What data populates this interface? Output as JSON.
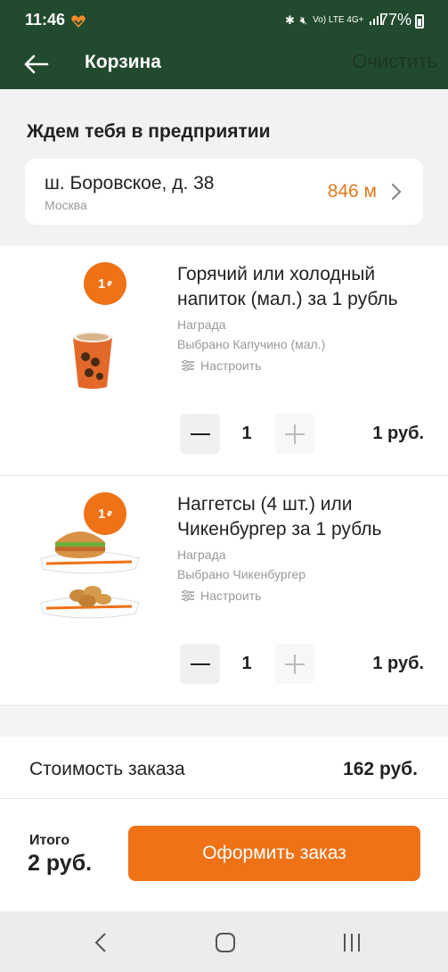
{
  "status_bar": {
    "time": "11:46",
    "signal_labels": "Vo) LTE 4G+",
    "battery": "77%"
  },
  "app_bar": {
    "title": "Корзина",
    "clear_label": "Очистить"
  },
  "pickup": {
    "heading": "Ждем тебя в предприятии",
    "street": "ш. Боровское, д. 38",
    "city": "Москва",
    "distance": "846 м"
  },
  "items": [
    {
      "badge": "1",
      "name": "Горячий или холодный напиток (мал.) за 1 рубль",
      "type": "Награда",
      "selected": "Выбрано Капучино (мал.)",
      "configure": "Настроить",
      "quantity": "1",
      "price": "1 руб.",
      "icon": "coffee-cup"
    },
    {
      "badge": "1",
      "name": "Наггетсы (4 шт.) или Чикенбургер за 1 рубль",
      "type": "Награда",
      "selected": "Выбрано Чикенбургер",
      "configure": "Настроить",
      "quantity": "1",
      "price": "1 руб.",
      "icon": "burger-and-nuggets"
    }
  ],
  "summary": {
    "label": "Стоимость заказа",
    "value": "162 руб."
  },
  "footer": {
    "total_label": "Итого",
    "total_value": "2 руб.",
    "checkout_label": "Оформить заказ"
  },
  "colors": {
    "header": "#224a2e",
    "accent": "#ef7217"
  }
}
